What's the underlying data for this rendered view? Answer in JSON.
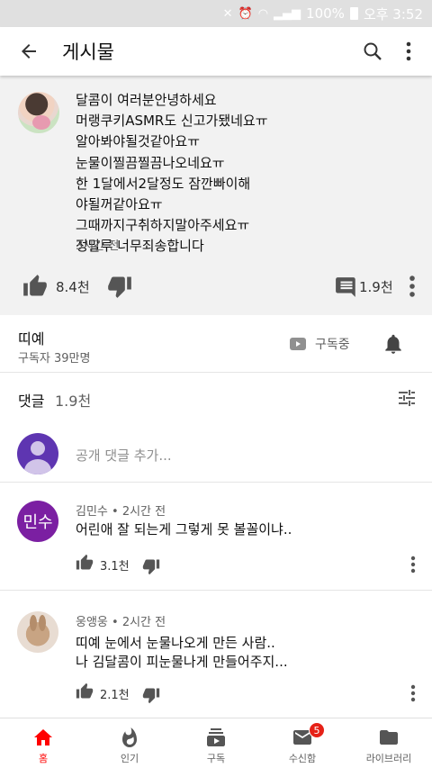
{
  "status_bar": {
    "battery": "100%",
    "time": "오후 3:52"
  },
  "app_bar": {
    "title": "게시물"
  },
  "post": {
    "lines": [
      "달콤이 여러분안녕하세요",
      "머랭쿠키ASMR도 신고가됐네요ㅠ",
      "알아봐야될것같아요ㅠ",
      "눈물이찔끔찔끔나오네요ㅠ",
      "한  1달에서2달정도 잠깐빠이해",
      "야될꺼같아요ㅠ",
      "그때까지구취하지말아주세요ㅠ",
      "정말루 너무죄송합니다"
    ],
    "time": "3시간 전",
    "likes": "8.4천",
    "comments": "1.9천"
  },
  "channel": {
    "name": "띠예",
    "subscribers": "구독자 39만명",
    "subscribe_label": "구독중"
  },
  "comments_section": {
    "label": "댓글",
    "count": "1.9천",
    "add_placeholder": "공개 댓글 추가...",
    "items": [
      {
        "author_initials": "민수",
        "meta": "김민수 • 2시간 전",
        "lines": [
          "어린애 잘 되는게 그렇게 못 볼꼴이냐.."
        ],
        "likes": "3.1천"
      },
      {
        "meta": "웅앵웅 • 2시간 전",
        "lines": [
          "띠예 눈에서 눈물나오게 만든 사람..",
          "나 김달콤이 피눈물나게 만들어주지..."
        ],
        "likes": "2.1천"
      }
    ]
  },
  "bottom_nav": {
    "items": [
      {
        "label": "홈",
        "icon": "home-icon"
      },
      {
        "label": "인기",
        "icon": "flame-icon"
      },
      {
        "label": "구독",
        "icon": "subscriptions-icon"
      },
      {
        "label": "수신함",
        "icon": "mail-icon",
        "badge": "5"
      },
      {
        "label": "라이브러리",
        "icon": "folder-icon"
      }
    ]
  },
  "colors": {
    "accent": "#ff0000",
    "post_bg": "#f2f2f2",
    "badge": "#e62117"
  }
}
